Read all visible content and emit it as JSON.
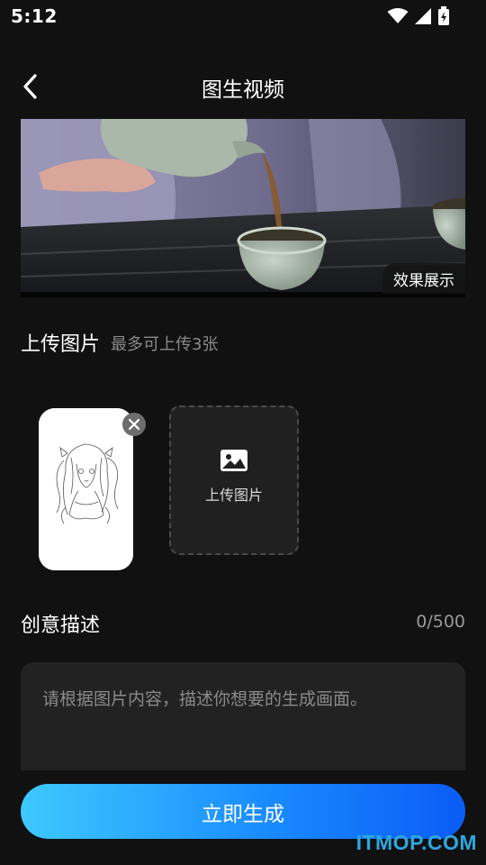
{
  "status_bar": {
    "time": "5:12",
    "icons": [
      "wifi-icon",
      "cell-signal-icon",
      "battery-charging-icon"
    ]
  },
  "header": {
    "title": "图生视频",
    "back_icon": "chevron-left-icon"
  },
  "preview": {
    "badge": "效果展示"
  },
  "upload": {
    "title": "上传图片",
    "hint": "最多可上传3张",
    "uploaded_count": 1,
    "add_button_label": "上传图片",
    "add_icon": "image-icon",
    "remove_icon": "close-icon"
  },
  "description": {
    "title": "创意描述",
    "counter": "0/500",
    "placeholder": "请根据图片内容，描述你想要的生成画面。",
    "value": ""
  },
  "actions": {
    "generate_label": "立即生成"
  },
  "watermark": "ITMOP.COM",
  "colors": {
    "background": "#111111",
    "accent_start": "#3ec9ff",
    "accent_end": "#0a5cf5",
    "watermark": "#2ea7e0"
  }
}
